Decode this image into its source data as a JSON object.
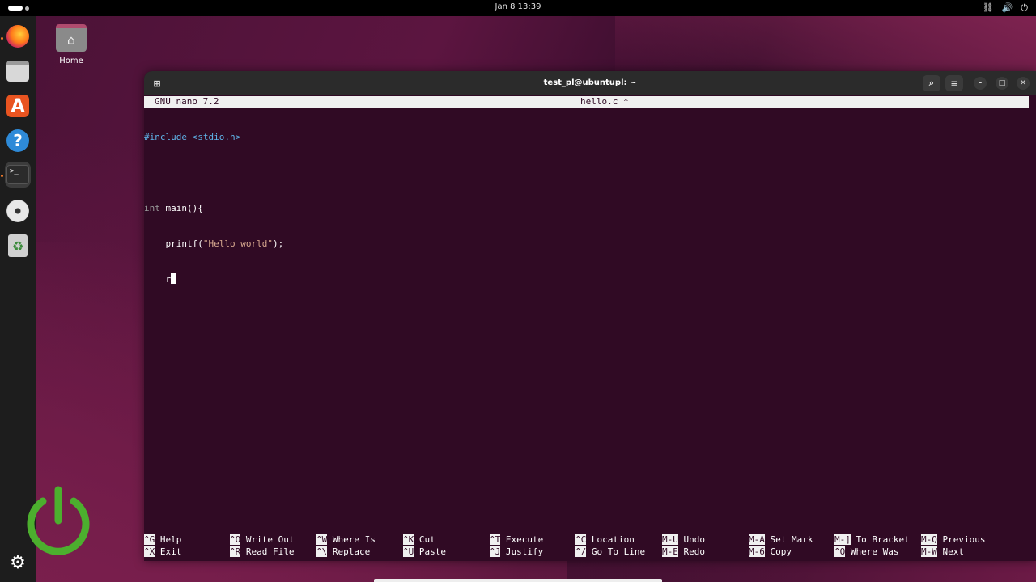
{
  "topbar": {
    "clock": "Jan 8  13:39",
    "tray_icons": [
      "network-icon",
      "volume-icon",
      "power-icon"
    ]
  },
  "dock": {
    "items": [
      {
        "name": "firefox",
        "icon": "firefox-icon"
      },
      {
        "name": "files",
        "icon": "files-icon"
      },
      {
        "name": "app-center",
        "icon": "app-center-icon",
        "glyph": "A"
      },
      {
        "name": "help",
        "icon": "help-icon",
        "glyph": "?"
      },
      {
        "name": "terminal",
        "icon": "terminal-icon",
        "glyph": ">_",
        "active": true
      },
      {
        "name": "disc",
        "icon": "disc-icon"
      },
      {
        "name": "trash",
        "icon": "trash-icon",
        "glyph": "♻"
      },
      {
        "name": "show-apps",
        "icon": "ubuntu-apps-icon",
        "glyph": "⚙"
      }
    ]
  },
  "desktop": {
    "home_label": "Home"
  },
  "window": {
    "title": "test_pl@ubuntupl: ~"
  },
  "nano": {
    "version": "GNU nano 7.2",
    "filename": "hello.c *",
    "lines": {
      "l1_pre": "#include <stdio.h>",
      "l3_type": "int",
      "l3_rest": " main(){",
      "l4_indent": "    printf(",
      "l4_str": "\"Hello world\"",
      "l4_end": ");",
      "l5_text": "    r"
    },
    "shortcuts": [
      [
        {
          "key": "^G",
          "label": "Help"
        },
        {
          "key": "^X",
          "label": "Exit"
        }
      ],
      [
        {
          "key": "^O",
          "label": "Write Out"
        },
        {
          "key": "^R",
          "label": "Read File"
        }
      ],
      [
        {
          "key": "^W",
          "label": "Where Is"
        },
        {
          "key": "^\\",
          "label": "Replace"
        }
      ],
      [
        {
          "key": "^K",
          "label": "Cut"
        },
        {
          "key": "^U",
          "label": "Paste"
        }
      ],
      [
        {
          "key": "^T",
          "label": "Execute"
        },
        {
          "key": "^J",
          "label": "Justify"
        }
      ],
      [
        {
          "key": "^C",
          "label": "Location"
        },
        {
          "key": "^/",
          "label": "Go To Line"
        }
      ],
      [
        {
          "key": "M-U",
          "label": "Undo"
        },
        {
          "key": "M-E",
          "label": "Redo"
        }
      ],
      [
        {
          "key": "M-A",
          "label": "Set Mark"
        },
        {
          "key": "M-6",
          "label": "Copy"
        }
      ],
      [
        {
          "key": "M-]",
          "label": "To Bracket"
        },
        {
          "key": "^Q",
          "label": "Where Was"
        }
      ],
      [
        {
          "key": "M-Q",
          "label": "Previous"
        },
        {
          "key": "M-W",
          "label": "Next"
        }
      ]
    ]
  },
  "colors": {
    "terminal_bg": "#300a24",
    "accent": "#e95420",
    "power_logo": "#4caf2e"
  }
}
